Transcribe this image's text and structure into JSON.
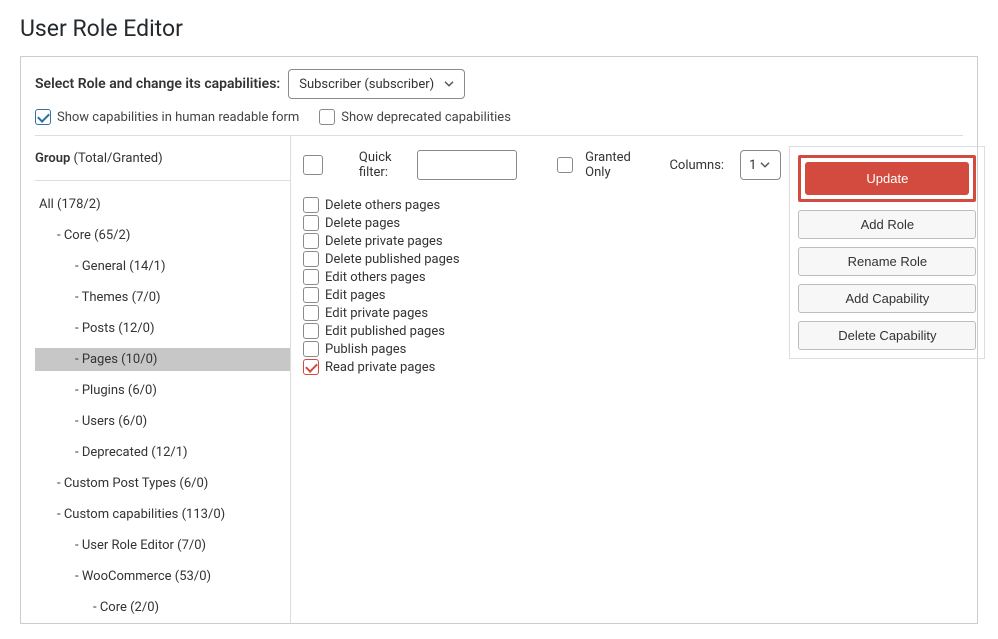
{
  "page_title": "User Role Editor",
  "topbar": {
    "label": "Select Role and change its capabilities:",
    "selected_role": "Subscriber (subscriber)"
  },
  "options": {
    "human_readable_label": "Show capabilities in human readable form",
    "human_readable_checked": true,
    "deprecated_label": "Show deprecated capabilities",
    "deprecated_checked": false
  },
  "sidebar": {
    "heading_bold": "Group",
    "heading_light": " (Total/Granted)",
    "tree": [
      {
        "label": "All (178/2)",
        "level": 0
      },
      {
        "label": "Core (65/2)",
        "level": 1,
        "dash": true
      },
      {
        "label": "General (14/1)",
        "level": 2,
        "dash": true
      },
      {
        "label": "Themes (7/0)",
        "level": 2,
        "dash": true
      },
      {
        "label": "Posts (12/0)",
        "level": 2,
        "dash": true
      },
      {
        "label": "Pages (10/0)",
        "level": 2,
        "dash": true,
        "selected": true
      },
      {
        "label": "Plugins (6/0)",
        "level": 2,
        "dash": true
      },
      {
        "label": "Users (6/0)",
        "level": 2,
        "dash": true
      },
      {
        "label": "Deprecated (12/1)",
        "level": 2,
        "dash": true
      },
      {
        "label": "Custom Post Types (6/0)",
        "level": 1,
        "dash": true
      },
      {
        "label": "Custom capabilities (113/0)",
        "level": 1,
        "dash": true
      },
      {
        "label": "User Role Editor (7/0)",
        "level": 2,
        "dash": true
      },
      {
        "label": "WooCommerce (53/0)",
        "level": 2,
        "dash": true
      },
      {
        "label": "Core (2/0)",
        "level": 3,
        "dash": true
      }
    ]
  },
  "filter": {
    "quick_filter_label": "Quick filter:",
    "granted_only_label": "Granted Only",
    "columns_label": "Columns:",
    "columns_value": "1"
  },
  "capabilities": [
    {
      "label": "Delete others pages",
      "checked": false
    },
    {
      "label": "Delete pages",
      "checked": false
    },
    {
      "label": "Delete private pages",
      "checked": false
    },
    {
      "label": "Delete published pages",
      "checked": false
    },
    {
      "label": "Edit others pages",
      "checked": false
    },
    {
      "label": "Edit pages",
      "checked": false
    },
    {
      "label": "Edit private pages",
      "checked": false
    },
    {
      "label": "Edit published pages",
      "checked": false
    },
    {
      "label": "Publish pages",
      "checked": false
    },
    {
      "label": "Read private pages",
      "checked": true
    }
  ],
  "actions": {
    "update": "Update",
    "add_role": "Add Role",
    "rename_role": "Rename Role",
    "add_capability": "Add Capability",
    "delete_capability": "Delete Capability"
  }
}
